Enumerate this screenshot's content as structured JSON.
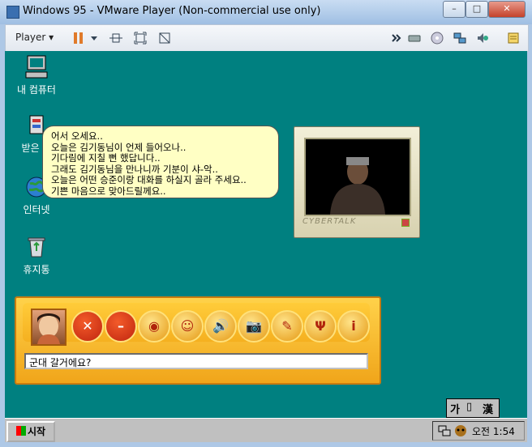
{
  "window": {
    "title": "Windows 95 - VMware Player (Non-commercial use only)",
    "minimize": "–",
    "maximize": "□",
    "close": "✕"
  },
  "toolbar": {
    "player_menu": "Player ▾"
  },
  "desktop": {
    "icons": [
      {
        "label": "내 컴퓨터",
        "icon": "computer-icon"
      },
      {
        "label": "받은 편",
        "icon": "inbox-icon"
      },
      {
        "label": "인터넷",
        "icon": "internet-icon"
      },
      {
        "label": "휴지통",
        "icon": "recycle-bin-icon"
      }
    ]
  },
  "balloon": {
    "lines": [
      "어서 오세요..",
      "오늘은 김기동님이 언제 들어오나..",
      "기다림에 지칠 뻔 했답니다..",
      "그래도 김기동님을 만나니까 기분이 샤-악..",
      "오늘은 어떤 승준이랑 대화를 하실지 골라 주세요..",
      "기쁜 마음으로 맞아드릴께요.."
    ]
  },
  "cybertalk": {
    "brand": "CYBERTALK",
    "input_value": "군대 갈거에요?",
    "buttons": [
      "✕",
      "–",
      "◉",
      "☺",
      "🔊",
      "📷",
      "✎",
      "Ψ",
      "i"
    ]
  },
  "ime": {
    "k1": "가",
    "k2": "▯",
    "k3": "漢"
  },
  "taskbar": {
    "start": "시작",
    "clock": "오전 1:54"
  }
}
